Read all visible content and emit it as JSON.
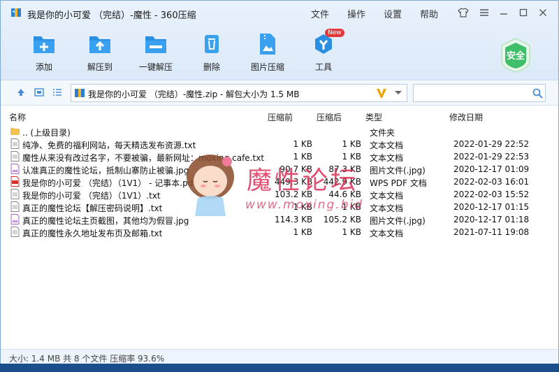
{
  "window": {
    "title": "我是你的小可爱 （完结）-魔性 - 360压缩",
    "menu": [
      "文件",
      "操作",
      "设置",
      "帮助"
    ]
  },
  "toolbar": {
    "buttons": [
      {
        "label": "添加",
        "icon": "add-icon"
      },
      {
        "label": "解压到",
        "icon": "extract-to-icon"
      },
      {
        "label": "一键解压",
        "icon": "one-click-extract-icon"
      },
      {
        "label": "删除",
        "icon": "delete-icon"
      },
      {
        "label": "图片压缩",
        "icon": "image-compress-icon"
      },
      {
        "label": "工具",
        "icon": "tools-icon"
      }
    ],
    "new_badge": "New",
    "safe_badge": "安全"
  },
  "address": {
    "text": "我是你的小可爱 （完结）-魔性.zip - 解包大小为 1.5 MB"
  },
  "columns": {
    "name": "名称",
    "compressed": "压缩前",
    "after": "压缩后",
    "type": "类型",
    "modified": "修改日期"
  },
  "files": [
    {
      "name": ".. (上级目录)",
      "before": "",
      "after": "",
      "type": "文件夹",
      "date": "",
      "icon": "folder-icon"
    },
    {
      "name": "纯净、免费的福利网站，每天精选发布资源.txt",
      "before": "1 KB",
      "after": "1 KB",
      "type": "文本文档",
      "date": "2022-01-29 22:52",
      "icon": "txt-file-icon"
    },
    {
      "name": "魔性从来没有改过名字，不要被骗，最新网址：moxing.cafe.txt",
      "before": "1 KB",
      "after": "1 KB",
      "type": "文本文档",
      "date": "2022-01-29 22:53",
      "icon": "txt-file-icon"
    },
    {
      "name": "认准真正的魔性论坛，抵制山寨防止被骗.jpg",
      "before": "90.7 KB",
      "after": "87.3 KB",
      "type": "图片文件(.jpg)",
      "date": "2020-12-17 01:09",
      "icon": "jpg-file-icon"
    },
    {
      "name": "我是你的小可爱 （完结）（1V1） - 记事本.pdf",
      "before": "449.3 KB",
      "after": "442.9 KB",
      "type": "WPS PDF 文档",
      "date": "2022-02-03 16:01",
      "icon": "pdf-file-icon"
    },
    {
      "name": "我是你的小可爱 （完结）（1V1）.txt",
      "before": "103.2 KB",
      "after": "44.6 KB",
      "type": "文本文档",
      "date": "2022-02-03 15:52",
      "icon": "txt-file-icon"
    },
    {
      "name": "真正的魔性论坛【解压密码说明】.txt",
      "before": "1 KB",
      "after": "1 KB",
      "type": "文本文档",
      "date": "2020-12-17 01:15",
      "icon": "txt-file-icon"
    },
    {
      "name": "真正的魔性论坛主页截图，其他均为假冒.jpg",
      "before": "114.3 KB",
      "after": "105.2 KB",
      "type": "图片文件(.jpg)",
      "date": "2020-12-17 01:18",
      "icon": "jpg-file-icon"
    },
    {
      "name": "真正的魔性永久地址发布页及邮箱.txt",
      "before": "1 KB",
      "after": "1 KB",
      "type": "文本文档",
      "date": "2021-07-11 19:08",
      "icon": "txt-file-icon"
    }
  ],
  "watermark": {
    "title": "魔性论坛",
    "url": "www.moxing.bid"
  },
  "status": {
    "text": "大小: 1.4 MB 共 8 个文件 压缩率 93.6%"
  },
  "colors": {
    "accent": "#2a7fd4",
    "header_bg": "#dbe9f8",
    "safe_green": "#3fbf6a",
    "watermark": "#dc2850"
  }
}
